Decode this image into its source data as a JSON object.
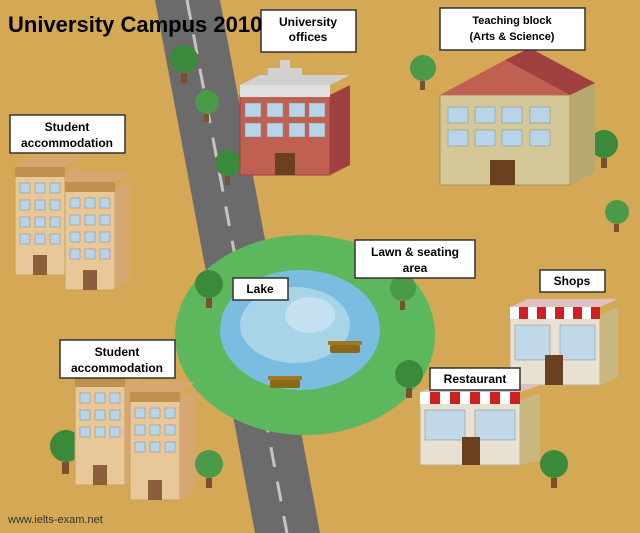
{
  "title": "University Campus 2010",
  "labels": {
    "university_offices": "University\noffices",
    "teaching_block": "Teaching block\n(Arts & Science)",
    "student_accommodation_1": "Student\naccommodation",
    "student_accommodation_2": "Student\naccommodation",
    "lawn_seating": "Lawn & seating\narea",
    "lake": "Lake",
    "shops": "Shops",
    "restaurant": "Restaurant"
  },
  "watermark": "www.ielts-exam.net",
  "colors": {
    "background": "#d4a855",
    "road": "#555555",
    "lawn": "#5db85d",
    "lake": "#a8cfe0",
    "building_red": "#c0524a",
    "building_tan": "#e8c898",
    "tree_green": "#3a8a3a",
    "label_bg": "#ffffff",
    "label_border": "#333333"
  }
}
